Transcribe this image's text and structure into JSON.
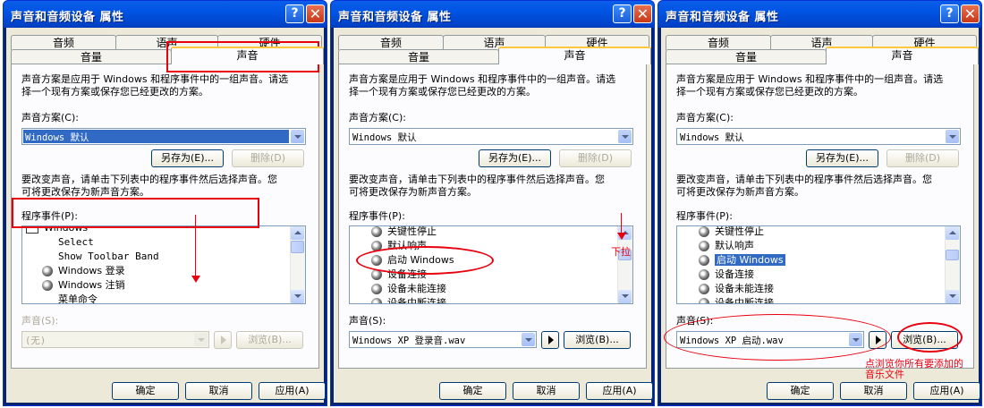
{
  "title": "声音和音频设备  属性",
  "help": "?",
  "close": "✕",
  "tabs": {
    "audio": "音频",
    "voice": "语声",
    "hardware": "硬件",
    "volume": "音量",
    "sounds": "声音"
  },
  "desc1": "声音方案是应用于 Windows 和程序事件中的一组声音。请选",
  "desc2": "择一个现有方案或保存您已经更改的方案。",
  "scheme_label": "声音方案(C):",
  "scheme_value": "Windows 默认",
  "save_as": "另存为(E)...",
  "delete": "删除(D)",
  "change1": "要改变声音，请单击下列表中的程序事件然后选择声音。您",
  "change2": "可将更改保存为新声音方案。",
  "events_label": "程序事件(P):",
  "panel1_events": [
    "Windows",
    "Select",
    "Show Toolbar Band",
    "Windows 登录",
    "Windows 注销",
    "菜单命令"
  ],
  "panel23_events": [
    "关键性停止",
    "默认响声",
    "启动 Windows",
    "设备连接",
    "设备未能连接",
    "设备中断连接"
  ],
  "sound_label": "声音(S):",
  "sound1": "(无)",
  "sound2": "Windows XP 登录音.wav",
  "sound3": "Windows XP 启动.wav",
  "browse": "浏览(B)...",
  "ok": "确定",
  "cancel": "取消",
  "apply": "应用(A)",
  "annotation_scroll": "下拉",
  "annotation_browse1": "点浏览你所有要添加的",
  "annotation_browse2": "音乐文件",
  "colors": {
    "annotation": "#e8000f",
    "titlebar": "#0054e3",
    "selection": "#316ac5"
  }
}
